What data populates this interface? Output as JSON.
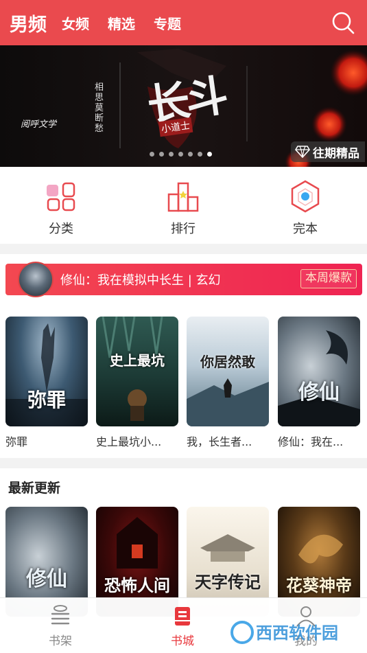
{
  "header": {
    "tabs": [
      {
        "label": "男频",
        "active": true
      },
      {
        "label": "女频",
        "active": false
      },
      {
        "label": "精选",
        "active": false
      },
      {
        "label": "专题",
        "active": false
      }
    ],
    "search_icon": "search-icon",
    "accent": "#ea4a4e"
  },
  "banner": {
    "title": "长斗",
    "subtitle": "小道士",
    "author": "相思莫断愁",
    "logo": "阅呼文学",
    "slide_count": 7,
    "active_slide": 6,
    "past_label": "往期精品"
  },
  "quick_nav": [
    {
      "label": "分类",
      "icon": "category-icon"
    },
    {
      "label": "排行",
      "icon": "ranking-icon"
    },
    {
      "label": "完本",
      "icon": "finished-icon"
    }
  ],
  "hot": {
    "text": "修仙：我在模拟中长生 | 玄幻",
    "badge": "本周爆款"
  },
  "books": [
    {
      "name": "弥罪",
      "cover_title": "弥罪"
    },
    {
      "name": "史上最坑小...",
      "cover_title": "史上最坑"
    },
    {
      "name": "我，长生者...",
      "cover_title": "你居然敢"
    },
    {
      "name": "修仙：我在...",
      "cover_title": "修仙"
    }
  ],
  "latest": {
    "title": "最新更新",
    "books": [
      {
        "cover_title": "修仙"
      },
      {
        "cover_title": "恐怖人间"
      },
      {
        "cover_title": "天字传记"
      },
      {
        "cover_title": "花葵神帝"
      }
    ]
  },
  "bottom_nav": [
    {
      "label": "书架",
      "icon": "bookshelf-icon",
      "active": false
    },
    {
      "label": "书城",
      "icon": "bookstore-icon",
      "active": true
    },
    {
      "label": "我的",
      "icon": "profile-icon",
      "active": false
    }
  ],
  "watermark": "西西软件园"
}
